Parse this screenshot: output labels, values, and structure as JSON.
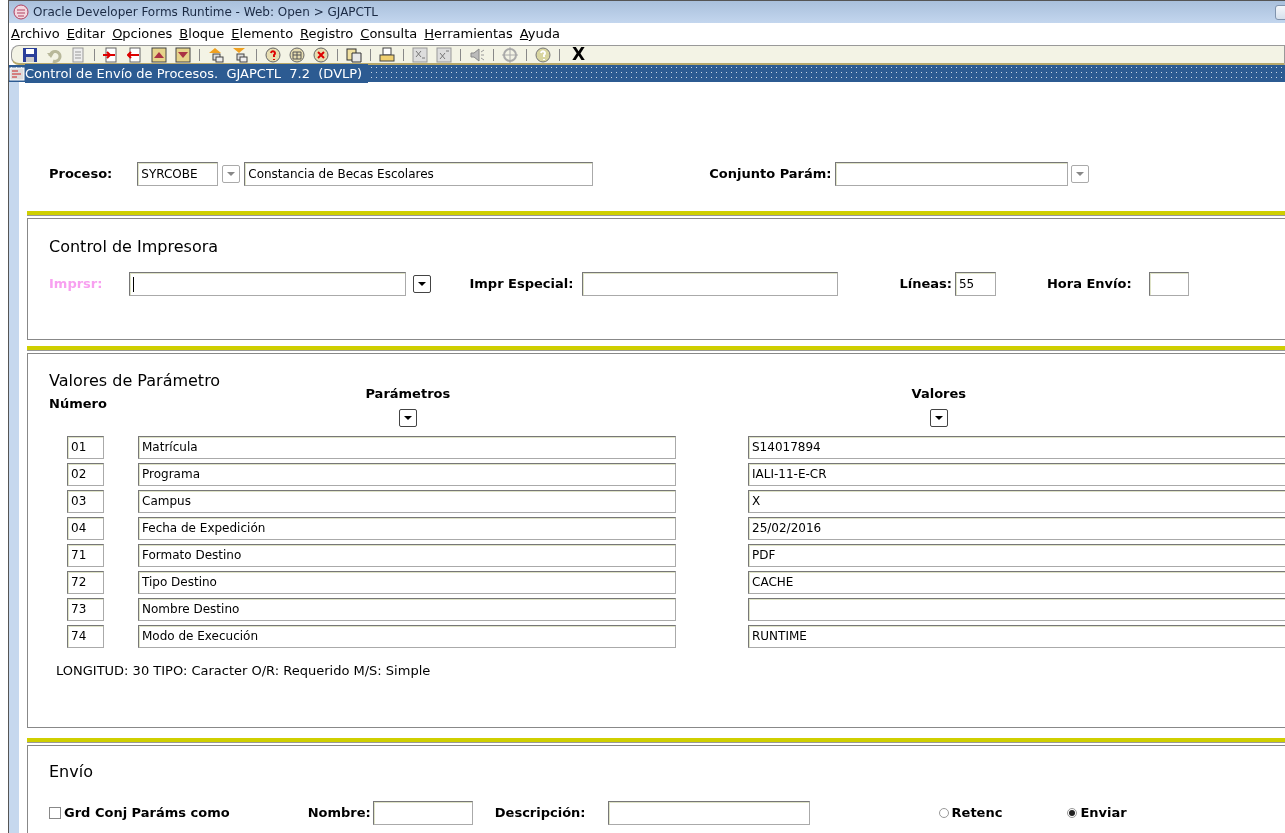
{
  "window": {
    "title": "Oracle Developer Forms Runtime - Web:  Open > GJAPCTL"
  },
  "menu": [
    {
      "label": "Archivo"
    },
    {
      "label": "Editar"
    },
    {
      "label": "Opciones"
    },
    {
      "label": "Bloque"
    },
    {
      "label": "Elemento"
    },
    {
      "label": "Registro"
    },
    {
      "label": "Consulta"
    },
    {
      "label": "Herramientas"
    },
    {
      "label": "Ayuda"
    }
  ],
  "toolbar": {
    "exit_label": "X"
  },
  "form_title": "Control de Envío de Procesos.  GJAPCTL  7.2  (DVLP)",
  "process": {
    "label": "Proceso:",
    "code": "SYRCOBE",
    "description": "Constancia de Becas Escolares",
    "param_set_label": "Conjunto Parám:"
  },
  "printer_control": {
    "title": "Control de Impresora",
    "printer_label": "Imprsr:",
    "printer_focused": true,
    "special_label": "Impr Especial:",
    "lines_label": "Líneas:",
    "lines_value": "55",
    "send_time_label": "Hora Envío:"
  },
  "parameters": {
    "title": "Valores de Parámetro",
    "number_header": "Número",
    "params_header": "Parámetros",
    "values_header": "Valores",
    "rows": [
      {
        "number": "01",
        "name": "Matrícula",
        "value": "S14017894"
      },
      {
        "number": "02",
        "name": "Programa",
        "value": "IALI-11-E-CR"
      },
      {
        "number": "03",
        "name": "Campus",
        "value": "X"
      },
      {
        "number": "04",
        "name": "Fecha de Expedición",
        "value": "25/02/2016"
      },
      {
        "number": "71",
        "name": "Formato Destino",
        "value": "PDF"
      },
      {
        "number": "72",
        "name": "Tipo Destino",
        "value": "CACHE"
      },
      {
        "number": "73",
        "name": "Nombre Destino"
      },
      {
        "number": "74",
        "name": "Modo de Execución",
        "value": "RUNTIME"
      }
    ],
    "hint": "LONGITUD: 30 TIPO: Caracter O/R: Requerido M/S: Simple"
  },
  "submission": {
    "title": "Envío",
    "save_set": {
      "label": "Grd Conj Paráms como",
      "checked": false
    },
    "name_label": "Nombre:",
    "description_label": "Descripción:",
    "modes": [
      {
        "label": "Retenc",
        "selected": false
      },
      {
        "label": "Enviar",
        "selected": true
      }
    ]
  }
}
